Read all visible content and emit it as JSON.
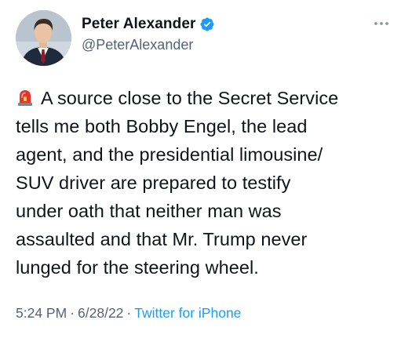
{
  "author": {
    "display_name": "Peter Alexander",
    "handle": "@PeterAlexander",
    "verified": true,
    "avatar_icon": "profile-photo-man-in-suit"
  },
  "tweet": {
    "emoji_icon": "police-car-light-siren-emoji",
    "lines": [
      "A source close to the Secret Service",
      "tells me both Bobby Engel, the lead",
      "agent, and the presidential limousine/",
      "SUV driver are prepared to testify",
      "under oath that neither man was",
      "assaulted and that Mr. Trump never",
      "lunged for the steering wheel."
    ]
  },
  "meta": {
    "time": "5:24 PM",
    "separator1": "·",
    "date": "6/28/22",
    "separator2": "·",
    "source": "Twitter for iPhone"
  },
  "colors": {
    "text": "#0f1419",
    "secondary": "#536471",
    "link": "#1d9bf0",
    "verified": "#1d9bf0",
    "siren": "#e8332a"
  }
}
